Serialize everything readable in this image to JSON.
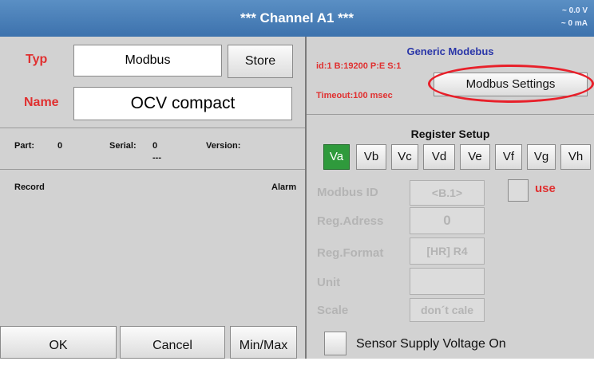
{
  "header": {
    "title": "*** Channel A1 ***",
    "voltage": "~ 0.0 V",
    "current": "~ 0 mA"
  },
  "left": {
    "typ_label": "Typ",
    "typ_value": "Modbus",
    "store_label": "Store",
    "name_label": "Name",
    "name_value": "OCV compact",
    "part_label": "Part:",
    "part_value": "0",
    "serial_label": "Serial:",
    "serial_value": "0",
    "serial_sub": "---",
    "version_label": "Version:",
    "record_label": "Record",
    "alarm_label": "Alarm"
  },
  "footer": {
    "ok": "OK",
    "cancel": "Cancel",
    "minmax": "Min/Max"
  },
  "right": {
    "generic": "Generic Modebus",
    "config": "id:1 B:19200 P:E S:1",
    "timeout": "Timeout:100 msec",
    "settings_btn": "Modbus Settings",
    "register_setup": "Register Setup",
    "registers": [
      "Va",
      "Vb",
      "Vc",
      "Vd",
      "Ve",
      "Vf",
      "Vg",
      "Vh"
    ],
    "active_register": "Va",
    "modbus_id_label": "Modbus ID",
    "modbus_id_value": "<B.1>",
    "use_label": "use",
    "reg_adress_label": "Reg.Adress",
    "reg_adress_value": "0",
    "reg_format_label": "Reg.Format",
    "reg_format_value": "[HR] R4",
    "unit_label": "Unit",
    "unit_value": "",
    "scale_label": "Scale",
    "scale_value": "don´t cale",
    "sensor_supply_label": "Sensor Supply Voltage On"
  },
  "colors": {
    "header": "#4a80ba",
    "panel": "#d2d2d2",
    "accent_red": "#e03030",
    "active_green": "#2f9a3c",
    "annotation_red": "#e8202a"
  }
}
